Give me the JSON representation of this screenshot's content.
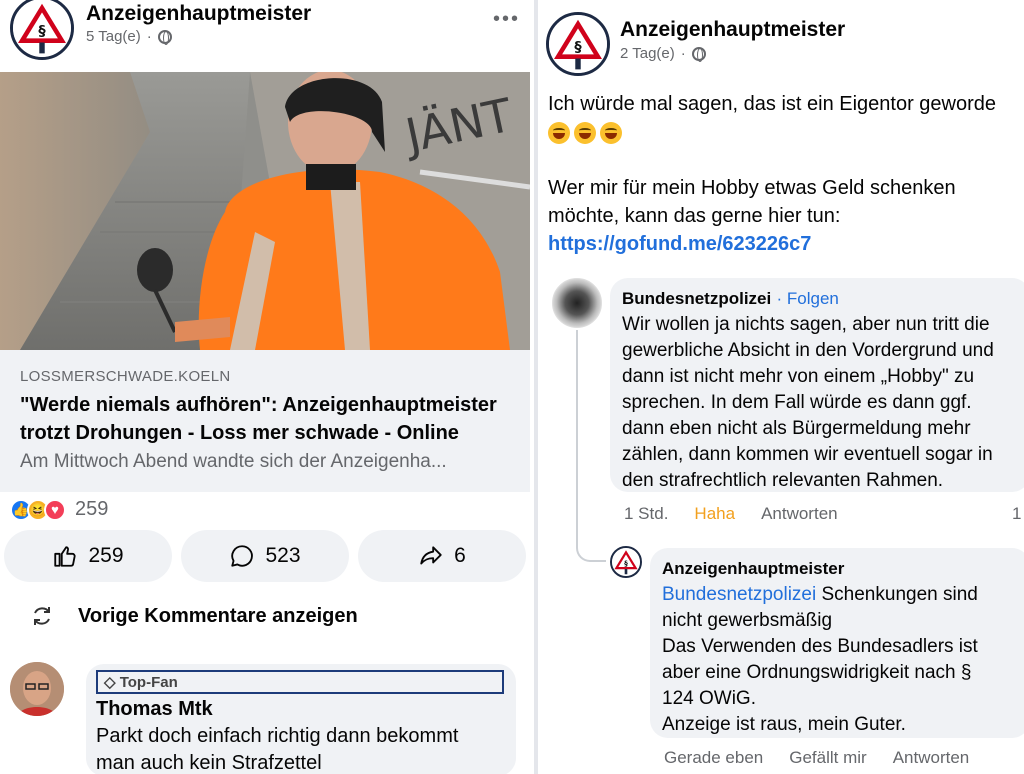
{
  "left_post": {
    "author": "Anzeigenhauptmeister",
    "time": "5 Tag(e)",
    "separator": "·",
    "more": "•••",
    "link": {
      "domain": "LOSSMERSCHWADE.KOELN",
      "title_line1": "\"Werde niemals aufhören\": Anzeigenhauptmeister",
      "title_line2": "trotzt Drohungen - Loss mer schwade - Online",
      "description": "Am Mittwoch Abend wandte sich der Anzeigenha..."
    },
    "reaction_count": "259",
    "actions": [
      {
        "icon": "thumbs-up-icon",
        "count": "259"
      },
      {
        "icon": "comment-icon",
        "count": "523"
      },
      {
        "icon": "share-icon",
        "count": "6"
      }
    ],
    "previous_comments_label": "Vorige Kommentare anzeigen",
    "comment": {
      "badge": "Top-Fan",
      "author": "Thomas Mtk",
      "text_line1": "Parkt doch einfach richtig dann bekommt",
      "text_line2": "man auch kein Strafzettel"
    }
  },
  "right_post": {
    "author": "Anzeigenhauptmeister",
    "time": "2 Tag(e)",
    "separator": "·",
    "text_line1": "Ich würde mal sagen, das ist ein Eigentor geworde",
    "text_line3": "Wer mir für mein Hobby etwas Geld schenken",
    "text_line4": "möchte, kann das gerne hier tun:",
    "link": "https://gofund.me/623226c7",
    "comment1": {
      "author": "Bundesnetzpolizei",
      "follow": "· Folgen",
      "lines": [
        "Wir wollen ja nichts sagen, aber nun tritt die",
        "gewerbliche Absicht in den Vordergrund und",
        "dann ist nicht mehr von einem „Hobby\" zu",
        "sprechen. In dem Fall würde es dann ggf.",
        "dann eben nicht als Bürgermeldung mehr",
        "zählen, dann kommen wir eventuell sogar in",
        "den strafrechtlich relevanten Rahmen."
      ],
      "time": "1 Std.",
      "reaction": "Haha",
      "reply": "Antworten",
      "count": "1"
    },
    "reply": {
      "author": "Anzeigenhauptmeister",
      "mention": "Bundesnetzpolizei",
      "line1_rest": " Schenkungen sind",
      "lines": [
        "nicht gewerbsmäßig",
        "Das Verwenden des Bundesadlers ist",
        "aber eine Ordnungswidrigkeit nach §",
        "124 OWiG.",
        "Anzeige ist raus, mein Guter."
      ],
      "time": "Gerade eben",
      "like": "Gefällt mir",
      "reply": "Antworten"
    }
  },
  "colors": {
    "link": "#216fdb",
    "haha": "#f2a01e",
    "bubble": "#f0f2f5"
  }
}
